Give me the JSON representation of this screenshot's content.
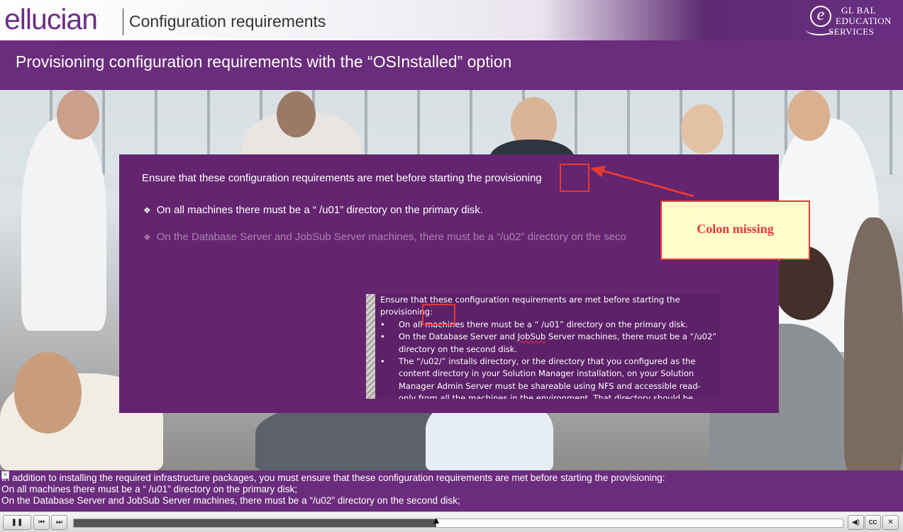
{
  "header": {
    "logo": "ellucian",
    "logo_mark": ".",
    "title": "Configuration requirements",
    "badge": {
      "letter": "e",
      "line1": "GL BAL",
      "line2": "EDUCATION",
      "line3": "SERVICES"
    }
  },
  "slide": {
    "title": "Provisioning configuration requirements with the “OSInstalled” option",
    "intro": "Ensure that these configuration requirements are met before starting the provisioning",
    "bullets": [
      "On all machines there must be a “ /u01” directory on the primary disk.",
      "On the Database Server and JobSub Server machines, there must be a “/u02” directory on the seco"
    ]
  },
  "document": {
    "intro_line1": "Ensure that these configuration requirements are met before starting the",
    "intro_line2": "provisioning:",
    "items": [
      {
        "pre": "On all machines there must be a “ /u01” directory on the primary disk.",
        "spell": "",
        "post": ""
      },
      {
        "pre": "On the Database Server and ",
        "spell": "JobSub",
        "post": " Server machines, there must be a “/u02” directory on the second disk."
      },
      {
        "pre": "The “/u02/” installs directory, or the directory that you configured as the content directory in your Solution Manager installation, on your Solution Manager Admin Server must be shareable using NFS and accessible read-only from all the machines in the environment. That directory should be",
        "spell": "",
        "post": ""
      }
    ]
  },
  "annotation": {
    "label": "Colon missing",
    "color": "#e53935"
  },
  "caption": {
    "lines": [
      "In addition to installing the required infrastructure packages, you must ensure that these configuration requirements are met before starting the provisioning:",
      "On all machines there must be a “ /u01” directory on the primary disk;",
      "On the Database Server and JobSub Server machines, there must be a “/u02” directory on the second disk;"
    ],
    "close_icon": "✕"
  },
  "player": {
    "progress": 0.471,
    "icons": {
      "pause": "❚❚",
      "prev": "⏮",
      "next": "⏭",
      "volume": "◀)",
      "cc": "CC",
      "close": "✕"
    }
  },
  "colors": {
    "brand_purple": "#6a2c7c",
    "content_purple": "#64246f"
  }
}
